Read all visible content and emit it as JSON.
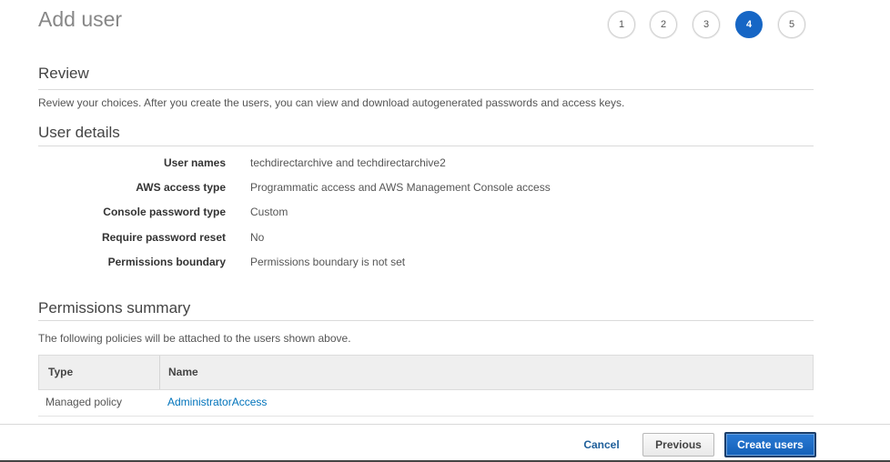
{
  "page": {
    "title": "Add user"
  },
  "steps": [
    {
      "label": "1",
      "active": false
    },
    {
      "label": "2",
      "active": false
    },
    {
      "label": "3",
      "active": false
    },
    {
      "label": "4",
      "active": true
    },
    {
      "label": "5",
      "active": false
    }
  ],
  "review": {
    "title": "Review",
    "description": "Review your choices. After you create the users, you can view and download autogenerated passwords and access keys."
  },
  "user_details": {
    "title": "User details",
    "rows": [
      {
        "label": "User names",
        "value": "techdirectarchive and techdirectarchive2"
      },
      {
        "label": "AWS access type",
        "value": "Programmatic access and AWS Management Console access"
      },
      {
        "label": "Console password type",
        "value": "Custom"
      },
      {
        "label": "Require password reset",
        "value": "No"
      },
      {
        "label": "Permissions boundary",
        "value": "Permissions boundary is not set"
      }
    ]
  },
  "permissions_summary": {
    "title": "Permissions summary",
    "description": "The following policies will be attached to the users shown above.",
    "columns": [
      "Type",
      "Name"
    ],
    "rows": [
      {
        "type": "Managed policy",
        "name": "AdministratorAccess"
      }
    ]
  },
  "footer": {
    "cancel_label": "Cancel",
    "previous_label": "Previous",
    "create_label": "Create users"
  },
  "colors": {
    "accent": "#1666c5",
    "link": "#0073bb"
  }
}
